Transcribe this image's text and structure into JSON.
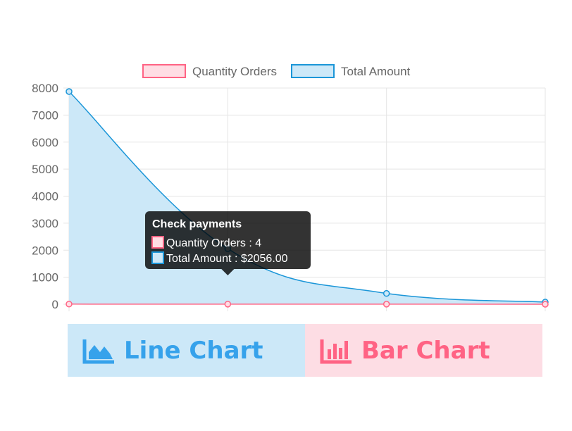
{
  "chart_data": {
    "type": "line",
    "categories": [
      "",
      "",
      "",
      ""
    ],
    "series": [
      {
        "name": "Quantity Orders",
        "values": [
          5,
          4,
          3,
          1
        ],
        "border_color": "#ff6384",
        "fill_color": "#ffdde4"
      },
      {
        "name": "Total Amount",
        "values": [
          7870,
          2056,
          400,
          80
        ],
        "border_color": "#1b96d8",
        "fill_color": "#cce8f8"
      }
    ],
    "ylim": [
      0,
      8000
    ],
    "yticks": [
      0,
      1000,
      2000,
      3000,
      4000,
      5000,
      6000,
      7000,
      8000
    ],
    "grid": true,
    "legend_position": "top",
    "tooltip": {
      "title": "Check payments",
      "lines": [
        "Quantity Orders : 4",
        "Total Amount : $2056.00"
      ],
      "index": 1
    }
  },
  "buttons": {
    "line_label": "Line Chart",
    "line_icon": "area-chart-icon",
    "bar_label": "Bar Chart",
    "bar_icon": "bar-chart-icon"
  },
  "colors": {
    "blue": "#36a2eb",
    "pink": "#ff6384"
  }
}
